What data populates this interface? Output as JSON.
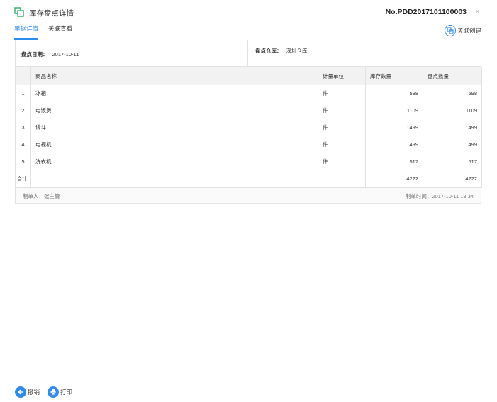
{
  "header": {
    "title": "库存盘点详情",
    "doc_no": "No.PDD2017101100003",
    "close": "×"
  },
  "tabs": [
    {
      "label": "单据详情",
      "active": true
    },
    {
      "label": "关联查看",
      "active": false
    }
  ],
  "actions": {
    "create_link": "关联创建",
    "cancel": "撤销",
    "print": "打印"
  },
  "info": {
    "date_label": "盘点日期：",
    "date_value": "2017-10-11",
    "warehouse_label": "盘点仓库：",
    "warehouse_value": "深圳仓库"
  },
  "table": {
    "columns": [
      "",
      "商品名称",
      "计量单位",
      "库存数量",
      "盘点数量"
    ],
    "rows": [
      {
        "idx": "1",
        "name": "冰箱",
        "unit": "件",
        "stock": "598",
        "count": "598"
      },
      {
        "idx": "2",
        "name": "电饭煲",
        "unit": "件",
        "stock": "1109",
        "count": "1109"
      },
      {
        "idx": "3",
        "name": "诱斗",
        "unit": "件",
        "stock": "1499",
        "count": "1499"
      },
      {
        "idx": "4",
        "name": "电视机",
        "unit": "件",
        "stock": "499",
        "count": "499"
      },
      {
        "idx": "5",
        "name": "洗衣机",
        "unit": "件",
        "stock": "517",
        "count": "517"
      }
    ],
    "total": {
      "label": "合计",
      "stock": "4222",
      "count": "4222"
    }
  },
  "footer": {
    "maker": "制单人：张主管",
    "made_time": "制单时间：2017-10-11 18:34"
  },
  "colors": {
    "accent": "#2d8cf0",
    "doc_icon": "#3cb371"
  },
  "icons": {
    "doc": "copy-icon",
    "create": "link-create-icon",
    "back": "arrow-left-icon",
    "print": "printer-icon",
    "close": "close-icon"
  }
}
